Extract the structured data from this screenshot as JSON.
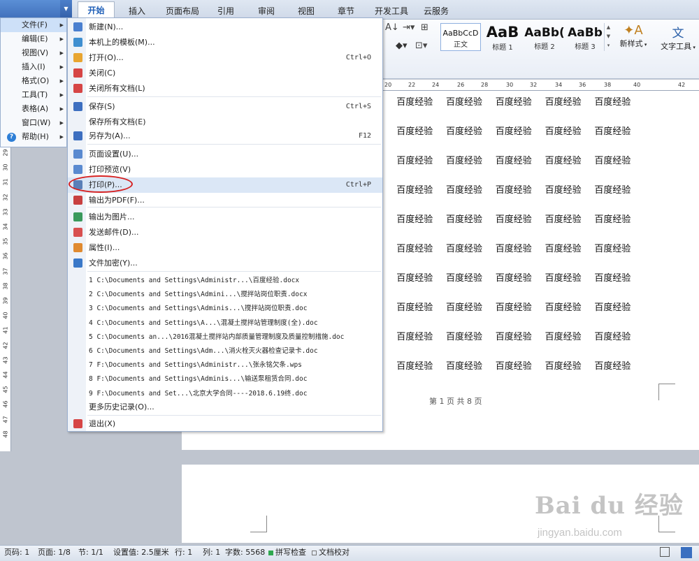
{
  "tabs": [
    "开始",
    "插入",
    "页面布局",
    "引用",
    "审阅",
    "视图",
    "章节",
    "开发工具",
    "云服务"
  ],
  "ribbon": {
    "styles": [
      {
        "preview": "AaBbCcD",
        "label": "正文"
      },
      {
        "preview": "AaB",
        "label": "标题 1"
      },
      {
        "preview": "AaBb(",
        "label": "标题 2"
      },
      {
        "preview": "AaBb",
        "label": "标题 3"
      }
    ],
    "new_style": "新样式",
    "text_tools": "文字工具"
  },
  "ruler": {
    "h": [
      "20",
      "22",
      "24",
      "26",
      "28",
      "30",
      "32",
      "34",
      "36",
      "38",
      "40",
      "42"
    ],
    "v": [
      "29",
      "30",
      "31",
      "32",
      "33",
      "34",
      "35",
      "36",
      "37",
      "38",
      "39",
      "40",
      "41",
      "42",
      "43",
      "44",
      "45",
      "46",
      "47",
      "48"
    ]
  },
  "left_menu": [
    {
      "label": "文件(F)",
      "key": "file"
    },
    {
      "label": "编辑(E)",
      "key": "edit"
    },
    {
      "label": "视图(V)",
      "key": "view"
    },
    {
      "label": "插入(I)",
      "key": "insert"
    },
    {
      "label": "格式(O)",
      "key": "format"
    },
    {
      "label": "工具(T)",
      "key": "tools"
    },
    {
      "label": "表格(A)",
      "key": "table"
    },
    {
      "label": "窗口(W)",
      "key": "window"
    },
    {
      "label": "帮助(H)",
      "key": "help"
    }
  ],
  "file_menu": {
    "items": [
      {
        "label": "新建(N)...",
        "shortcut": "",
        "icon": "new-doc-icon",
        "color": "#4a7fcf"
      },
      {
        "label": "本机上的模板(M)...",
        "shortcut": "",
        "icon": "template-icon",
        "color": "#3f8fd0"
      },
      {
        "label": "打开(O)...",
        "shortcut": "Ctrl+O",
        "icon": "open-folder-icon",
        "color": "#e8a530"
      },
      {
        "label": "关闭(C)",
        "shortcut": "",
        "icon": "close-doc-icon",
        "color": "#d64545"
      },
      {
        "label": "关闭所有文档(L)",
        "shortcut": "",
        "icon": "close-all-icon",
        "color": "#d64545"
      },
      {
        "label": "保存(S)",
        "shortcut": "Ctrl+S",
        "icon": "save-icon",
        "color": "#3d6fc0"
      },
      {
        "label": "保存所有文档(E)",
        "shortcut": "",
        "icon": "",
        "color": ""
      },
      {
        "label": "另存为(A)...",
        "shortcut": "F12",
        "icon": "save-as-icon",
        "color": "#3d6fc0"
      },
      {
        "label": "页面设置(U)...",
        "shortcut": "",
        "icon": "page-setup-icon",
        "color": "#5a8ad0"
      },
      {
        "label": "打印预览(V)",
        "shortcut": "",
        "icon": "print-preview-icon",
        "color": "#5a8ad0"
      },
      {
        "label": "打印(P)...",
        "shortcut": "Ctrl+P",
        "icon": "print-icon",
        "color": "#5a7fb8"
      },
      {
        "label": "输出为PDF(F)...",
        "shortcut": "",
        "icon": "pdf-icon",
        "color": "#c84040"
      },
      {
        "label": "输出为图片...",
        "shortcut": "",
        "icon": "image-export-icon",
        "color": "#3a9a5c"
      },
      {
        "label": "发送邮件(D)...",
        "shortcut": "",
        "icon": "mail-icon",
        "color": "#d85050"
      },
      {
        "label": "属性(I)...",
        "shortcut": "",
        "icon": "properties-icon",
        "color": "#e08a30"
      },
      {
        "label": "文件加密(Y)...",
        "shortcut": "",
        "icon": "encrypt-icon",
        "color": "#3a78c8"
      }
    ],
    "recent": [
      "1 C:\\Documents and Settings\\Administr...\\百度经验.docx",
      "2 C:\\Documents and Settings\\Admini...\\搅拌站岗位职责.docx",
      "3 C:\\Documents and Settings\\Adminis...\\搅拌站岗位职责.doc",
      "4 C:\\Documents and Settings\\A...\\混凝土搅拌站管理制度(全).doc",
      "5 C:\\Documents an...\\2016混凝土搅拌站内部质量管理制度及质量控制措施.doc",
      "6 C:\\Documents and Settings\\Adm...\\消火栓灭火器检查记录卡.doc",
      "7 F:\\Documents and Settings\\Administr...\\张永铭欠条.wps",
      "8 F:\\Documents and Settings\\Adminis...\\输送泵租赁合同.doc",
      "9 F:\\Documents and Set...\\北京大学合同----2018.6.19终.doc"
    ],
    "more_history": "更多历史记录(O)...",
    "exit": "退出(X)"
  },
  "document": {
    "word": "百度经验",
    "lines_visible": 10,
    "footer": "第 1 页 共 8 页"
  },
  "status": {
    "page_code": "页码: 1",
    "page": "页面: 1/8",
    "section": "节: 1/1",
    "setting": "设置值: 2.5厘米",
    "row": "行: 1",
    "col": "列: 1",
    "words": "字数: 5568",
    "spell": "拼写检查",
    "proof": "文档校对"
  },
  "watermark": {
    "brand": "Bai du 经验",
    "url": "jingyan.baidu.com"
  }
}
